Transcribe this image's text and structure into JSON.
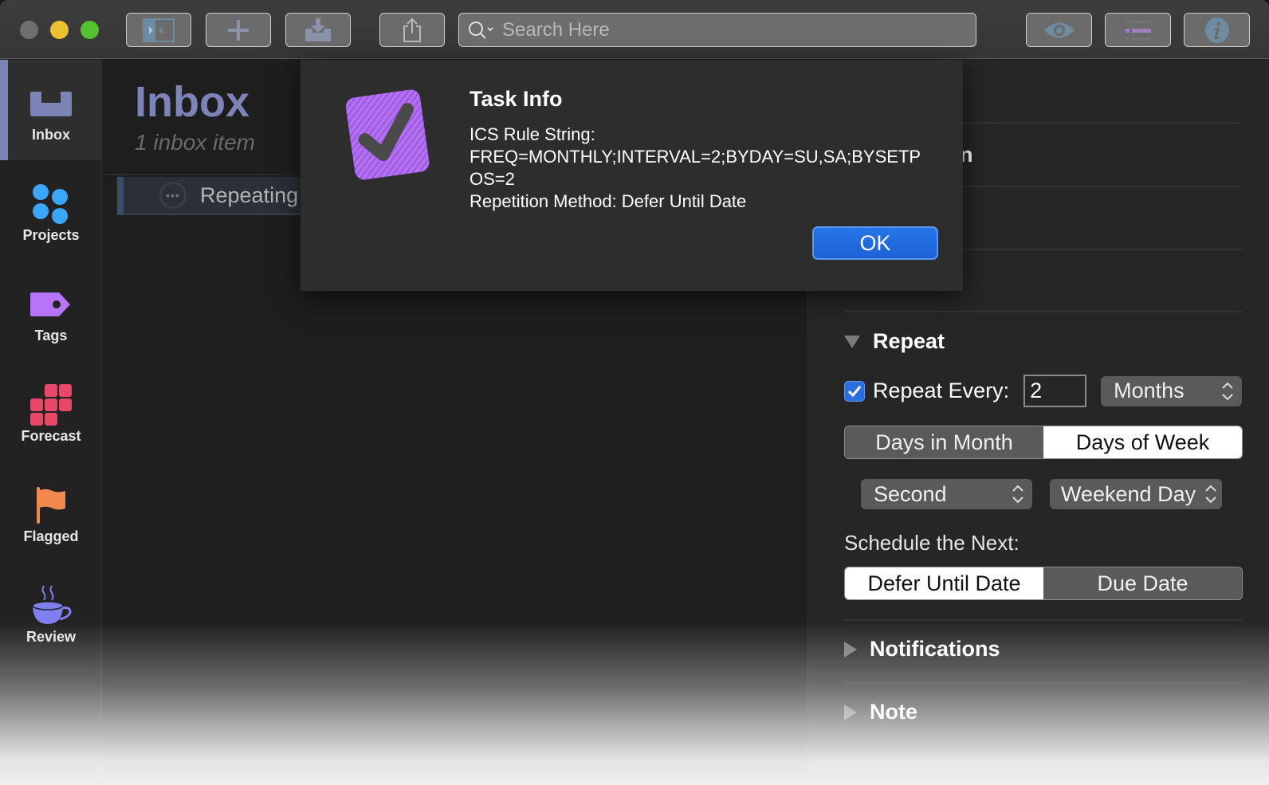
{
  "toolbar": {
    "search_placeholder": "Search Here",
    "buttons": [
      "sidebar-toggle",
      "new-item",
      "quick-entry",
      "share",
      "perspective",
      "outline-view",
      "inspector"
    ]
  },
  "sidebar": {
    "items": [
      {
        "label": "Inbox",
        "icon": "inbox-icon",
        "active": true,
        "color": "#7b84b4"
      },
      {
        "label": "Projects",
        "icon": "projects-icon",
        "color": "#3ba7fb"
      },
      {
        "label": "Tags",
        "icon": "tag-icon",
        "color": "#b874f8"
      },
      {
        "label": "Forecast",
        "icon": "forecast-icon",
        "color": "#e8476a"
      },
      {
        "label": "Flagged",
        "icon": "flag-icon",
        "color": "#f28a4f"
      },
      {
        "label": "Review",
        "icon": "review-cup-icon",
        "color": "#7f7ff0"
      }
    ]
  },
  "outline": {
    "title": "Inbox",
    "subtitle": "1 inbox item",
    "tasks": [
      {
        "title": "Repeating"
      }
    ]
  },
  "dialog": {
    "title": "Task Info",
    "line1": "ICS Rule String:",
    "line2": "FREQ=MONTHLY;INTERVAL=2;BYDAY=SU,SA;BYSETPOS=2",
    "line3": "Repetition Method: Defer Until Date",
    "ok_label": "OK"
  },
  "inspector": {
    "partial_text": "n",
    "repeat": {
      "heading": "Repeat",
      "repeat_every_label": "Repeat Every:",
      "repeat_every_checked": true,
      "interval_value": "2",
      "unit": "Months",
      "mode_segments": [
        "Days in Month",
        "Days of Week"
      ],
      "mode_selected": "Days of Week",
      "ordinal": "Second",
      "day_kind": "Weekend Day",
      "schedule_label": "Schedule the Next:",
      "schedule_segments": [
        "Defer Until Date",
        "Due Date"
      ],
      "schedule_selected": "Defer Until Date"
    },
    "notifications_heading": "Notifications",
    "note_heading": "Note"
  },
  "colors": {
    "accent_blue": "#1c63d6",
    "inbox_title": "#7d84b8"
  }
}
